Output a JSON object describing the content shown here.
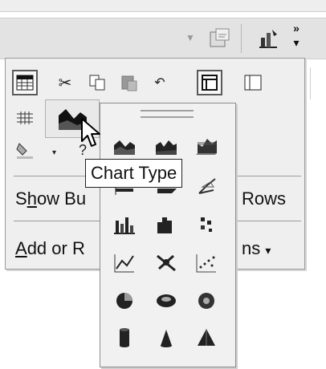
{
  "toolbar": {
    "icons": [
      "dropdown-arrow-icon",
      "properties-icon",
      "chart-wizard-icon",
      "more-buttons-chevron-icon"
    ]
  },
  "menu": {
    "row1_icons": [
      "format-table-icon",
      "cut-icon",
      "copy-icon",
      "paste-icon",
      "undo-icon",
      "frame-icon",
      "columns-icon"
    ],
    "row2_icons": [
      "grid-icon",
      "chart-type-icon",
      "dropdown-arrow-icon"
    ],
    "row3_icons": [
      "fill-color-icon",
      "dropdown-arrow-icon",
      "help-icon"
    ],
    "show_buttons": {
      "prefix": "S",
      "hotkey": "h",
      "rest": "ow Bu",
      "tail": "Rows"
    },
    "add_remove": {
      "hotkey": "A",
      "rest": "dd or R",
      "tail": "ns",
      "arrow": "▾"
    }
  },
  "chart_palette": {
    "tooltip": "Chart Type",
    "selected": "area-chart-icon",
    "icons": [
      "area-chart-icon",
      "area-3d-icon",
      "area-3d-stacked-icon",
      "surface-chart-icon",
      "bar-chart-icon",
      "bar-3d-icon",
      "radar-chart-icon",
      "column-chart-icon",
      "column-3d-icon",
      "bubble-chart-icon",
      "line-chart-icon",
      "xy-scatter-icon",
      "scatter-points-icon",
      "pie-chart-icon",
      "doughnut-chart-icon",
      "pie-3d-icon",
      "cylinder-chart-icon",
      "cone-chart-icon",
      "pyramid-chart-icon"
    ]
  }
}
